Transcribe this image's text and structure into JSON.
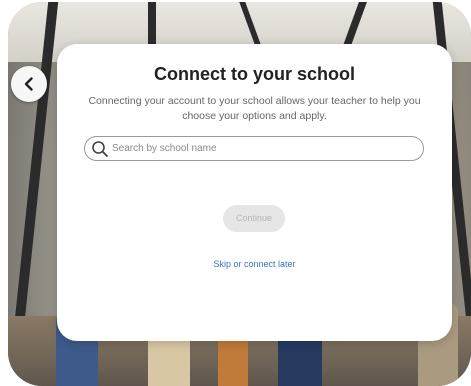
{
  "dialog": {
    "title": "Connect to your school",
    "subtitle": "Connecting your account to your school allows your teacher to help you choose your options and apply.",
    "search": {
      "placeholder": "Search by school name",
      "value": ""
    },
    "continue_label": "Continue",
    "skip_label": "Skip or connect later"
  },
  "icons": {
    "back": "chevron-left-icon",
    "search": "search-icon"
  },
  "colors": {
    "link": "#3b73c5",
    "disabled_button_bg": "#e6e6e6",
    "disabled_button_text": "#b5b5b5"
  }
}
